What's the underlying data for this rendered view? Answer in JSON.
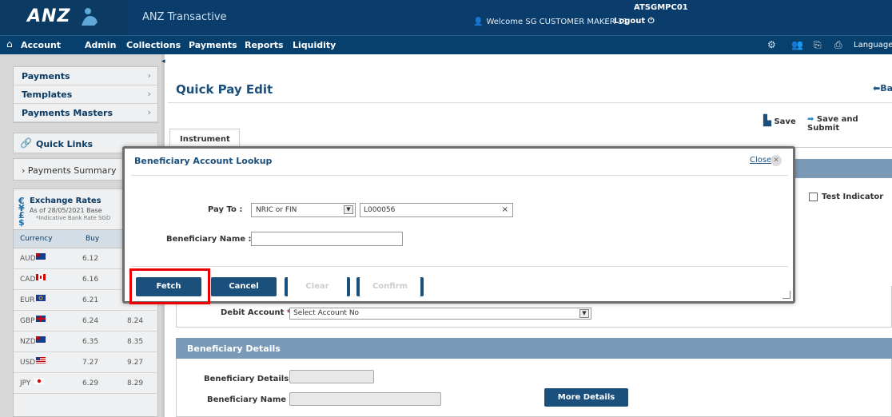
{
  "header": {
    "logo": "ANZ",
    "app_title": "ANZ Transactive",
    "user_id": "ATSGMPC01",
    "welcome": "Welcome SG CUSTOMER MAKER 11",
    "logout": "Logout"
  },
  "nav": {
    "items": [
      "Account",
      "Admin",
      "Collections",
      "Payments",
      "Reports",
      "Liquidity"
    ],
    "language": "Language"
  },
  "sidebar": {
    "menu": [
      {
        "label": "Payments"
      },
      {
        "label": "Templates"
      },
      {
        "label": "Payments Masters"
      }
    ],
    "quick_links": "Quick Links",
    "payments_summary": "Payments Summary",
    "fx": {
      "title": "Exchange Rates",
      "as_of": "As of  28/05/2021    Base",
      "indicative": "*Indicative Bank Rate    SGD",
      "col_currency": "Currency",
      "col_buy": "Buy",
      "rows": [
        {
          "ccy": "AUD",
          "buy": "6.12",
          "sell": ""
        },
        {
          "ccy": "CAD",
          "buy": "6.16",
          "sell": ""
        },
        {
          "ccy": "EUR",
          "buy": "6.21",
          "sell": ""
        },
        {
          "ccy": "GBP",
          "buy": "6.24",
          "sell": "8.24"
        },
        {
          "ccy": "NZD",
          "buy": "6.35",
          "sell": "8.35"
        },
        {
          "ccy": "USD",
          "buy": "7.27",
          "sell": "9.27"
        },
        {
          "ccy": "JPY",
          "buy": "6.29",
          "sell": "8.29"
        }
      ]
    }
  },
  "main": {
    "title": "Quick Pay Edit",
    "back": "Bac",
    "save": "Save",
    "save_submit": "Save and Submit",
    "tab": "Instrument",
    "test_indicator": "Test Indicator",
    "debit_account_label": "Debit Account",
    "debit_account_value": "Select Account No",
    "beneficiary_section": "Beneficiary Details",
    "beneficiary_details_label": "Beneficiary Details :",
    "beneficiary_name_label": "Beneficiary Name",
    "more_details": "More Details"
  },
  "modal": {
    "title": "Beneficiary Account Lookup",
    "close": "Close",
    "pay_to_label": "Pay To :",
    "pay_to_type": "NRIC or FIN",
    "pay_to_value": "L000056",
    "beneficiary_name_label": "Beneficiary Name :",
    "buttons": {
      "fetch": "Fetch",
      "cancel": "Cancel",
      "clear": "Clear",
      "confirm": "Confirm"
    }
  },
  "colors": {
    "header_bg": "#0a3d6b",
    "button_blue": "#1b4f7c",
    "section_header": "#7a9ab8",
    "highlight": "#ee0000"
  }
}
